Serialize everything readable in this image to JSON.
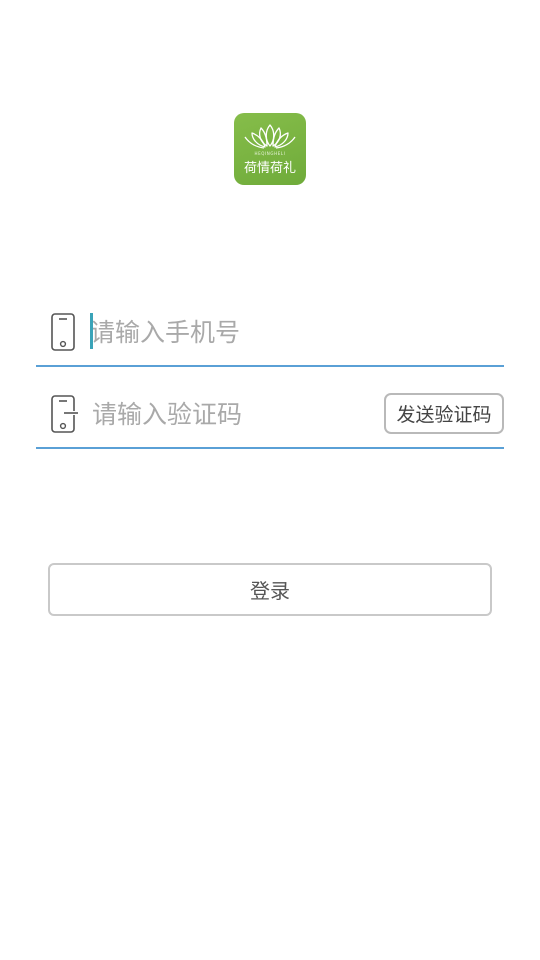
{
  "app": {
    "logo_sub": "HEQINGHELI",
    "logo_text": "荷情荷礼",
    "brand_color": "#7cb342"
  },
  "phone_field": {
    "icon": "phone-icon",
    "placeholder": "请输入手机号",
    "value": ""
  },
  "code_field": {
    "icon": "phone-code-icon",
    "placeholder": "请输入验证码",
    "value": "",
    "send_label": "发送验证码"
  },
  "login": {
    "label": "登录"
  },
  "colors": {
    "underline": "#5aa0d6",
    "caret": "#3aa3b8",
    "placeholder": "#a9a9a9"
  }
}
